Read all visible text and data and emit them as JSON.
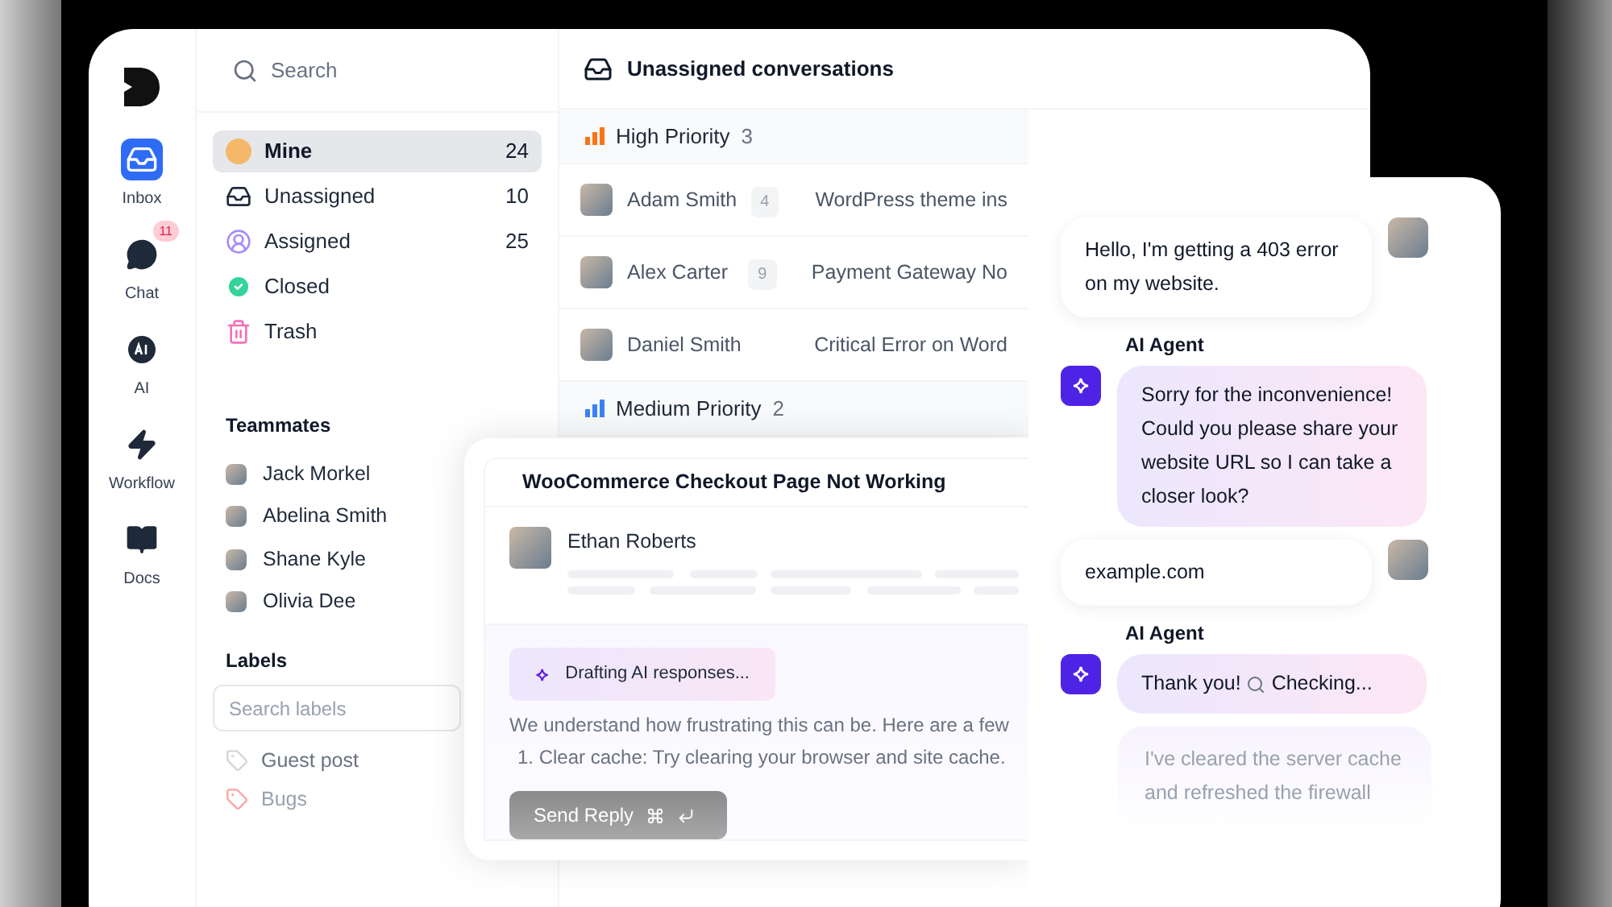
{
  "rail": [
    {
      "label": "Inbox",
      "selected": true
    },
    {
      "label": "Chat",
      "selected": false,
      "badge": "11"
    },
    {
      "label": "AI",
      "selected": false
    },
    {
      "label": "Workflow",
      "selected": false
    },
    {
      "label": "Docs",
      "selected": false
    }
  ],
  "sidebar": {
    "search": {
      "placeholder": "Search"
    },
    "folders": [
      {
        "label": "Mine",
        "count": "24",
        "selected": true
      },
      {
        "label": "Unassigned",
        "count": "10",
        "selected": false
      },
      {
        "label": "Assigned",
        "count": "25",
        "selected": false
      },
      {
        "label": "Closed",
        "selected": false
      },
      {
        "label": "Trash",
        "selected": false
      }
    ],
    "teammates_title": "Teammates",
    "teammates": [
      "Jack Morkel",
      "Abelina Smith",
      "Shane Kyle",
      "Olivia Dee"
    ],
    "labels_title": "Labels",
    "labels_search": {
      "placeholder": "Search labels"
    },
    "labels": [
      "Guest post",
      "Bugs"
    ]
  },
  "list": {
    "title": "Unassigned conversations",
    "groups": [
      {
        "name": "High Priority",
        "count": "3",
        "color": "#f97316",
        "rows": [
          {
            "name": "Adam Smith",
            "count": "4",
            "subject": "WordPress theme ins"
          },
          {
            "name": "Alex Carter",
            "count": "9",
            "subject": "Payment Gateway No"
          },
          {
            "name": "Daniel Smith",
            "subject": "Critical Error on Word"
          }
        ]
      },
      {
        "name": "Medium Priority",
        "count": "2",
        "color": "#3b82f6"
      }
    ]
  },
  "ticket": {
    "title": "WooCommerce Checkout Page Not Working",
    "customer": "Ethan Roberts",
    "ai_status": "Drafting AI responses...",
    "draft": "We understand how frustrating this can be. Here are a few",
    "steps": [
      "1. Clear cache: Try clearing your browser and site cache."
    ],
    "button": "Send Reply"
  },
  "chat": {
    "messages": [
      {
        "kind": "customer",
        "text": "Hello, I'm getting a 403 error on my website."
      },
      {
        "kind": "agent",
        "sender": "AI Agent",
        "text": "Sorry for the inconvenience! Could you please share your website URL so I can take a closer look?"
      },
      {
        "kind": "customer",
        "text": "example.com"
      },
      {
        "kind": "agent",
        "sender": "AI Agent",
        "text": "Thank you!",
        "text_after": "Checking..."
      },
      {
        "kind": "agent_faded",
        "text": "I've cleared the server cache and refreshed the firewall"
      }
    ]
  }
}
